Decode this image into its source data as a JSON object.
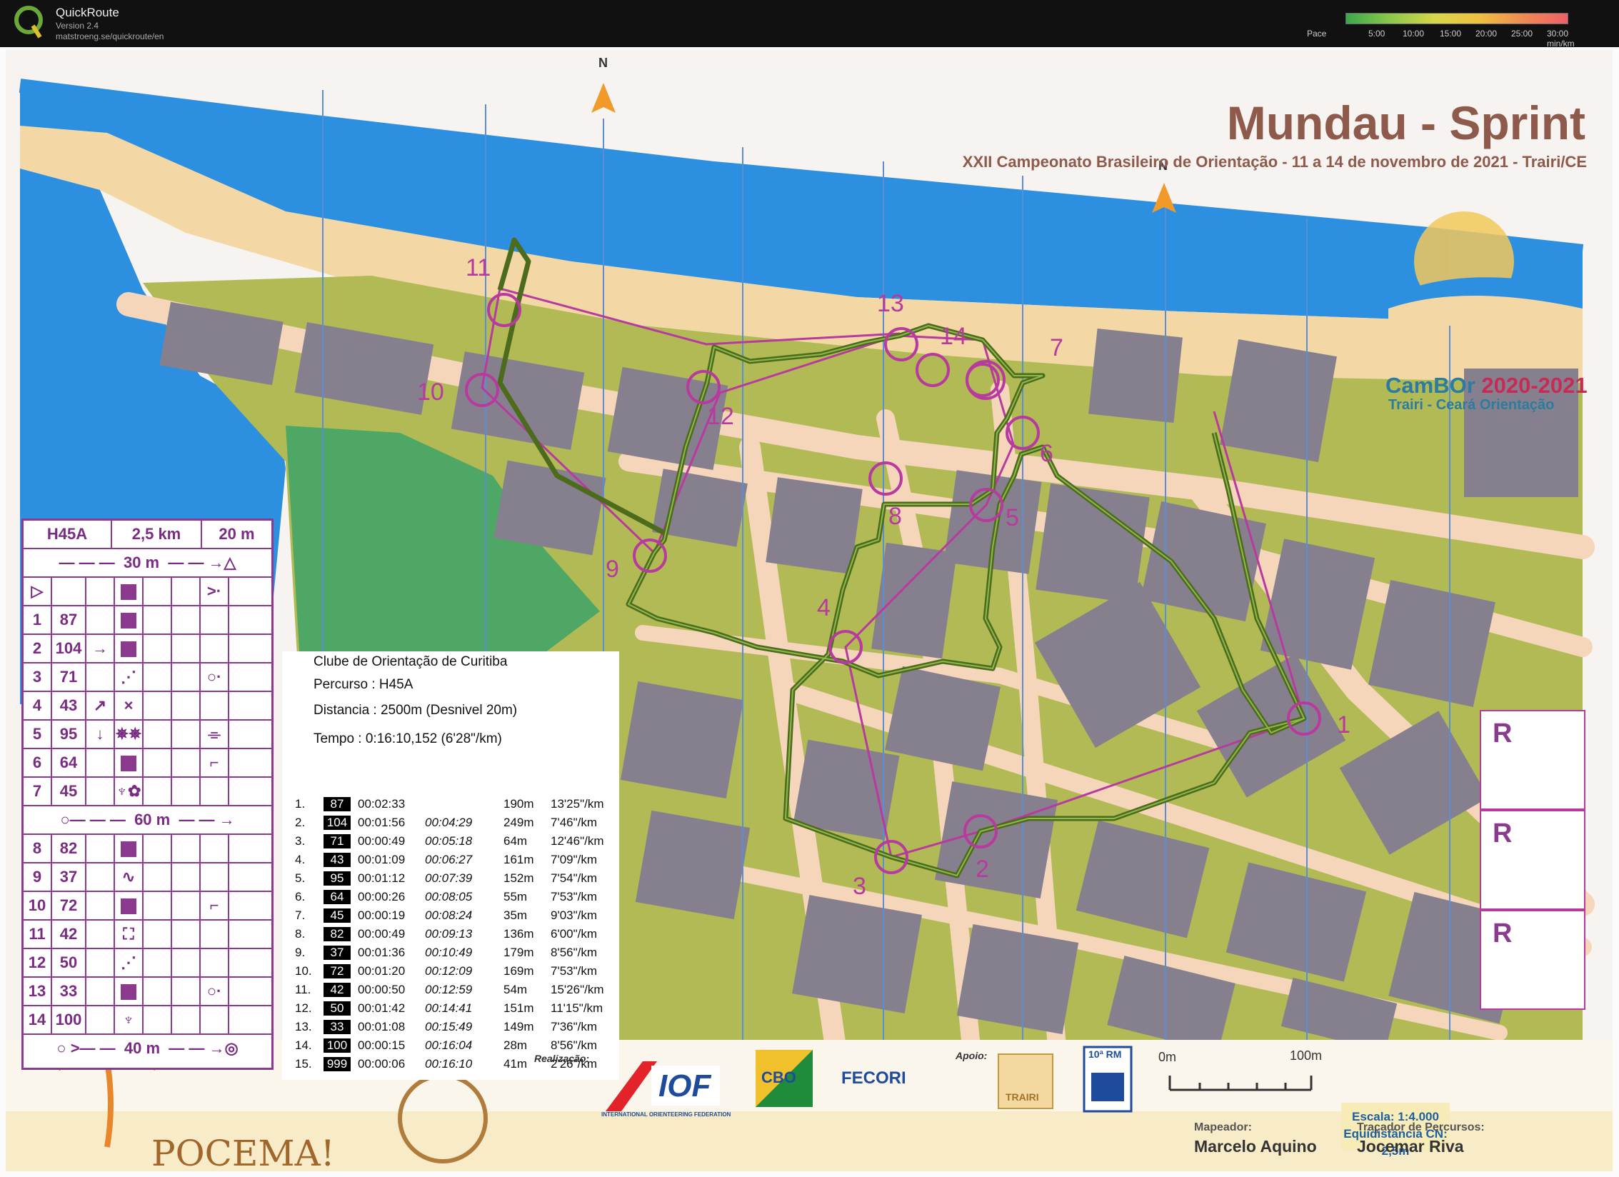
{
  "app": {
    "name": "QuickRoute",
    "version": "Version 2.4",
    "url": "matstroeng.se/quickroute/en",
    "pace_label": "Pace",
    "pace_ticks": [
      "5:00",
      "10:00",
      "15:00",
      "20:00",
      "25:00",
      "30:00 min/km"
    ]
  },
  "map": {
    "title": "Mundau - Sprint",
    "subtitle": "XXII Campeonato Brasileiro de Orientação - 11 a 14 de novembro de 2021 - Trairi/CE",
    "cambor": "CamBOr",
    "cambor_years": "2020-2021",
    "cambor_sub": "Trairi - Ceará  Orientação",
    "north": "N",
    "controls": [
      "1",
      "2",
      "3",
      "4",
      "5",
      "6",
      "7",
      "8",
      "9",
      "10",
      "11",
      "12",
      "13",
      "14"
    ],
    "r_labels": [
      "R",
      "R",
      "R"
    ],
    "scale_text": "Escala: 1:4.000",
    "contour_text": "Equidistância CN: 2,5m",
    "scale_start": "0m",
    "scale_end": "100m",
    "realizacao_label": "Realização:",
    "apoio_label": "Apoio:",
    "iof_text": "IOF",
    "iof_sub": "INTERNATIONAL ORIENTEERING FEDERATION",
    "cbo_text": "CBO",
    "fecori_text": "FECORI",
    "trairi_text": "TRAIRI",
    "rm_text": "10ª RM",
    "pocema_text": "POCEMA!",
    "mapper_label": "Mapeador:",
    "mapper_name": "Marcelo Aquino",
    "setter_label": "Traçador de Percursos:",
    "setter_name": "Jocemar Riva"
  },
  "course_table": {
    "class": "H45A",
    "length": "2,5 km",
    "climb": "20 m",
    "start_dist": "30 m",
    "mid_dist": "60 m",
    "end_dist": "40 m",
    "rows": [
      {
        "n": "1",
        "code": "87",
        "dir": "",
        "sym": "square",
        "extra": ""
      },
      {
        "n": "2",
        "code": "104",
        "dir": "→",
        "sym": "square",
        "extra": ""
      },
      {
        "n": "3",
        "code": "71",
        "dir": "",
        "sym": "dots",
        "extra": "○·"
      },
      {
        "n": "4",
        "code": "43",
        "dir": "↗",
        "sym": "×",
        "extra": ""
      },
      {
        "n": "5",
        "code": "95",
        "dir": "↓",
        "sym": "✵✵",
        "extra": "⌯"
      },
      {
        "n": "6",
        "code": "64",
        "dir": "",
        "sym": "square",
        "extra": "⌐"
      },
      {
        "n": "7",
        "code": "45",
        "dir": "",
        "sym": "♆✿",
        "extra": ""
      },
      {
        "n": "8",
        "code": "82",
        "dir": "",
        "sym": "square",
        "extra": ""
      },
      {
        "n": "9",
        "code": "37",
        "dir": "",
        "sym": "∿",
        "extra": ""
      },
      {
        "n": "10",
        "code": "72",
        "dir": "",
        "sym": "square",
        "extra": "⌐"
      },
      {
        "n": "11",
        "code": "42",
        "dir": "",
        "sym": "⛶",
        "extra": ""
      },
      {
        "n": "12",
        "code": "50",
        "dir": "",
        "sym": "dots",
        "extra": ""
      },
      {
        "n": "13",
        "code": "33",
        "dir": "",
        "sym": "square",
        "extra": "○·"
      },
      {
        "n": "14",
        "code": "100",
        "dir": "",
        "sym": "♆",
        "extra": ""
      }
    ]
  },
  "splits": {
    "club": "Clube de Orientação de Curitiba",
    "course": "Percurso : H45A",
    "distance": "Distancia : 2500m (Desnivel 20m)",
    "time": "Tempo : 0:16:10,152 (6'28\"/km)",
    "rows": [
      {
        "n": "1.",
        "code": "87",
        "split": "00:02:33",
        "cum": "",
        "dist": "190m",
        "pace": "13'25\"/km"
      },
      {
        "n": "2.",
        "code": "104",
        "split": "00:01:56",
        "cum": "00:04:29",
        "dist": "249m",
        "pace": "7'46\"/km"
      },
      {
        "n": "3.",
        "code": "71",
        "split": "00:00:49",
        "cum": "00:05:18",
        "dist": "64m",
        "pace": "12'46\"/km"
      },
      {
        "n": "4.",
        "code": "43",
        "split": "00:01:09",
        "cum": "00:06:27",
        "dist": "161m",
        "pace": "7'09\"/km"
      },
      {
        "n": "5.",
        "code": "95",
        "split": "00:01:12",
        "cum": "00:07:39",
        "dist": "152m",
        "pace": "7'54\"/km"
      },
      {
        "n": "6.",
        "code": "64",
        "split": "00:00:26",
        "cum": "00:08:05",
        "dist": "55m",
        "pace": "7'53\"/km"
      },
      {
        "n": "7.",
        "code": "45",
        "split": "00:00:19",
        "cum": "00:08:24",
        "dist": "35m",
        "pace": "9'03\"/km"
      },
      {
        "n": "8.",
        "code": "82",
        "split": "00:00:49",
        "cum": "00:09:13",
        "dist": "136m",
        "pace": "6'00\"/km"
      },
      {
        "n": "9.",
        "code": "37",
        "split": "00:01:36",
        "cum": "00:10:49",
        "dist": "179m",
        "pace": "8'56\"/km"
      },
      {
        "n": "10.",
        "code": "72",
        "split": "00:01:20",
        "cum": "00:12:09",
        "dist": "169m",
        "pace": "7'53\"/km"
      },
      {
        "n": "11.",
        "code": "42",
        "split": "00:00:50",
        "cum": "00:12:59",
        "dist": "54m",
        "pace": "15'26\"/km"
      },
      {
        "n": "12.",
        "code": "50",
        "split": "00:01:42",
        "cum": "00:14:41",
        "dist": "151m",
        "pace": "11'15\"/km"
      },
      {
        "n": "13.",
        "code": "33",
        "split": "00:01:08",
        "cum": "00:15:49",
        "dist": "149m",
        "pace": "7'36\"/km"
      },
      {
        "n": "14.",
        "code": "100",
        "split": "00:00:15",
        "cum": "00:16:04",
        "dist": "28m",
        "pace": "8'56\"/km"
      },
      {
        "n": "15.",
        "code": "999",
        "split": "00:00:06",
        "cum": "00:16:10",
        "dist": "41m",
        "pace": "2'26\"/km"
      }
    ]
  },
  "colors": {
    "sea": "#2c8fe0",
    "sand": "#f3d8a5",
    "building": "#86808e",
    "green": "#b1ba55",
    "road": "#f6d6bb",
    "course": "#b83a9f",
    "route": "#5a7a22",
    "forest": "#4fa765"
  }
}
